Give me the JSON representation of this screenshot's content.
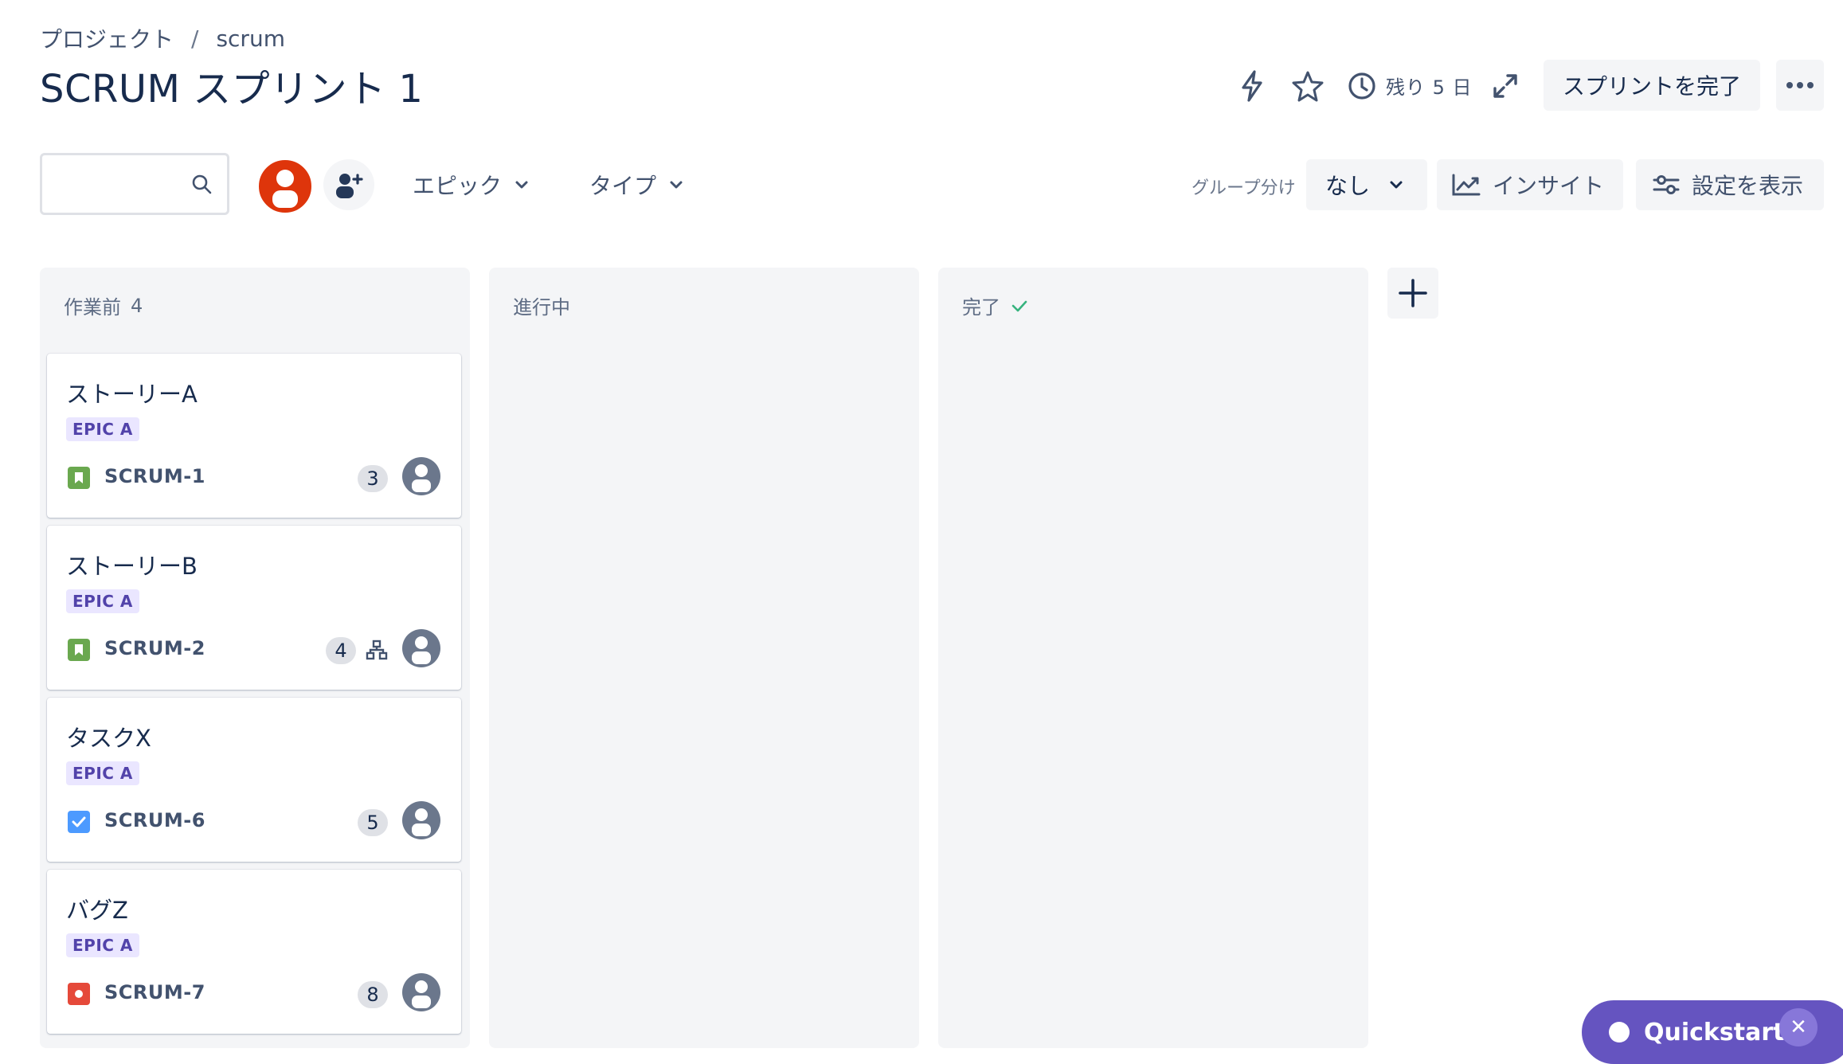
{
  "breadcrumb": {
    "project": "プロジェクト",
    "separator": "/",
    "name": "scrum"
  },
  "title": "SCRUM スプリント 1",
  "header": {
    "remaining": "残り 5 日",
    "complete_sprint": "スプリントを完了"
  },
  "toolbar": {
    "search_placeholder": "",
    "epic_filter": "エピック",
    "type_filter": "タイプ",
    "group_label": "グループ分け",
    "group_value": "なし",
    "insight": "インサイト",
    "display_settings": "設定を表示"
  },
  "columns": [
    {
      "title": "作業前",
      "count": "4"
    },
    {
      "title": "進行中"
    },
    {
      "title": "完了"
    }
  ],
  "cards": [
    {
      "title": "ストーリーA",
      "epic": "EPIC A",
      "key": "SCRUM-1",
      "points": "3",
      "type": "story"
    },
    {
      "title": "ストーリーB",
      "epic": "EPIC A",
      "key": "SCRUM-2",
      "points": "4",
      "type": "story",
      "has_subtasks": true
    },
    {
      "title": "タスクX",
      "epic": "EPIC A",
      "key": "SCRUM-6",
      "points": "5",
      "type": "task"
    },
    {
      "title": "バグZ",
      "epic": "EPIC A",
      "key": "SCRUM-7",
      "points": "8",
      "type": "bug"
    }
  ],
  "quickstart": {
    "label": "Quickstart"
  },
  "colors": {
    "story": "#6aa84f",
    "task": "#4c9aff",
    "bug": "#e5493a",
    "epic_bg": "#eae6ff",
    "epic_text": "#5243aa",
    "quickstart": "#6554c0",
    "avatar_main": "#de350b"
  }
}
